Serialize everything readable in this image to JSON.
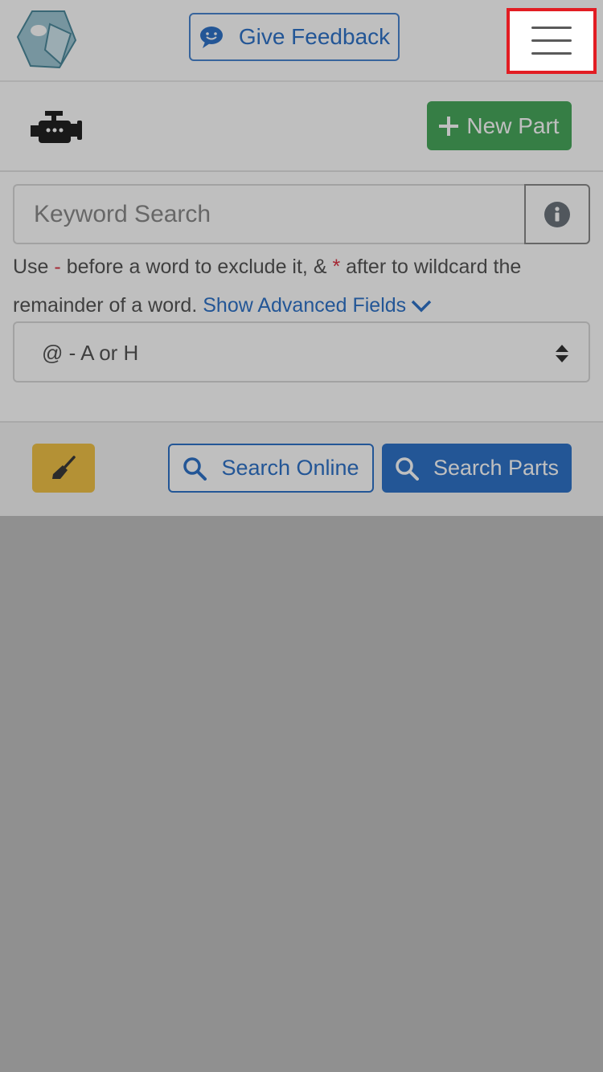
{
  "header": {
    "feedback_label": "Give Feedback",
    "icons": {
      "logo": "hexagon-logo-icon",
      "feedback": "chat-smile-icon",
      "menu": "hamburger-menu-icon"
    }
  },
  "toolbar": {
    "new_part_label": "New Part",
    "icons": {
      "engine": "engine-icon",
      "plus": "plus-icon"
    }
  },
  "search": {
    "placeholder": "Keyword Search",
    "value": "",
    "help": {
      "text_1": "Use",
      "dash": "-",
      "text_2": "before a word to exclude it, &",
      "star": "*",
      "text_3": "after to wildcard the remainder of a word.",
      "advanced_link": "Show Advanced Fields"
    },
    "select_value": "@ - A or H"
  },
  "actions": {
    "search_online_label": "Search Online",
    "search_parts_label": "Search Parts",
    "icons": {
      "clear": "broom-icon",
      "search": "magnifier-icon"
    }
  },
  "colors": {
    "primary": "#2f73c9",
    "success": "#48a85d",
    "warning": "#f0c247",
    "danger": "#dc3545",
    "highlight_border": "#e21d23",
    "overlay": "rgba(0,0,0,0.25)"
  }
}
